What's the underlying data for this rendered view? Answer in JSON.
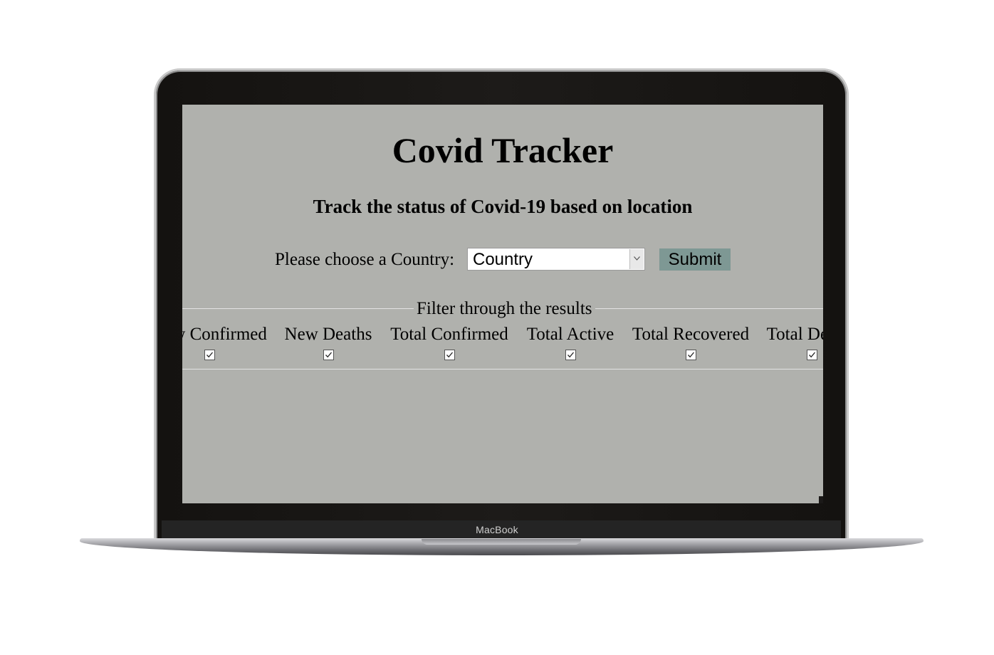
{
  "device": {
    "brand_label": "MacBook"
  },
  "app": {
    "title": "Covid Tracker",
    "subtitle": "Track the status of Covid-19 based on location",
    "country_prompt": "Please choose a Country:",
    "country_select": {
      "selected": "Country"
    },
    "submit_label": "Submit",
    "colors": {
      "page_background": "#b0b1ad",
      "submit_background": "#7e9894"
    }
  },
  "filters": {
    "legend": "Filter through the results",
    "items": [
      {
        "label": "New Confirmed",
        "checked": true
      },
      {
        "label": "New Deaths",
        "checked": true
      },
      {
        "label": "Total Confirmed",
        "checked": true
      },
      {
        "label": "Total Active",
        "checked": true
      },
      {
        "label": "Total Recovered",
        "checked": true
      },
      {
        "label": "Total Deaths",
        "checked": true
      }
    ]
  }
}
